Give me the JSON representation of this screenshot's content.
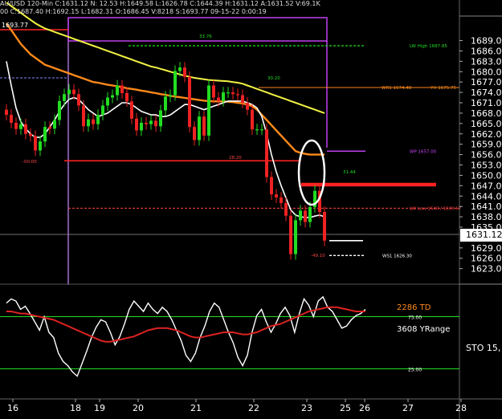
{
  "header": {
    "line1": "AU/USD  120-Min  C:1631.12  N:  12.53  H:1649.58  L:1626.78  C:1644.39  H:1631.12  A:1631.52  V:69.1K",
    "line2": "00  C:1687.40  H:1692.15  L:1682.31  O:1686.45  V:8218  S:1693.77  09-15-22  0:00:19",
    "left_price_label": "1693.77"
  },
  "colors": {
    "background": "#000000",
    "bull": "#22dd22",
    "bear": "#ee2222",
    "ma_fast": "#ffffff",
    "ma_mid": "#ff8a1a",
    "ma_slow": "#f2f244",
    "stoch_k": "#ffffff",
    "stoch_d": "#dd2222",
    "magenta": "#cc44ff",
    "current_price_box": "#ffffff"
  },
  "current_price": "1631.12",
  "chart_data": [
    {
      "type": "candlestick",
      "ylim": [
        1621,
        1694
      ],
      "x_tick_labels": [
        {
          "label": "16",
          "index": -2
        },
        {
          "label": "18",
          "index": 11
        },
        {
          "label": "19",
          "index": 16
        },
        {
          "label": "20",
          "index": 24
        },
        {
          "label": "21",
          "index": 36
        },
        {
          "label": "22",
          "index": 48
        },
        {
          "label": "23",
          "index": 59
        },
        {
          "label": "25",
          "index": 67
        },
        {
          "label": "26",
          "index": 71
        },
        {
          "label": "27",
          "index": 80
        },
        {
          "label": "28",
          "index": 91
        }
      ],
      "y_tick_labels": [
        "1689.00",
        "1686.00",
        "1683.00",
        "1680.00",
        "1677.00",
        "1674.00",
        "1671.00",
        "1668.00",
        "1665.00",
        "1662.00",
        "1659.00",
        "1656.00",
        "1653.00",
        "1650.00",
        "1647.00",
        "1644.00",
        "1641.00",
        "1638.00",
        "1635.00",
        "1629.00",
        "1626.00",
        "1623.00"
      ],
      "y_tick_values": [
        1689,
        1686,
        1683,
        1680,
        1677,
        1674,
        1671,
        1668,
        1665,
        1662,
        1659,
        1656,
        1653,
        1650,
        1647,
        1644,
        1641,
        1638,
        1635,
        1629,
        1626,
        1623
      ],
      "candles_close": [
        1667.5,
        1665.2,
        1663.4,
        1664.8,
        1662.0,
        1661.4,
        1657.2,
        1659.8,
        1664.0,
        1663.5,
        1666.0,
        1671.5,
        1673.5,
        1674.8,
        1673.5,
        1670.2,
        1664.2,
        1666.2,
        1664.8,
        1667.5,
        1670.2,
        1672.5,
        1673.2,
        1676.0,
        1673.8,
        1671.4,
        1666.4,
        1663.0,
        1665.2,
        1664.8,
        1665.8,
        1664.2,
        1668.8,
        1672.8,
        1673.2,
        1680.2,
        1681.2,
        1678.5,
        1664.0,
        1660.2,
        1667.0,
        1661.5,
        1676.0,
        1672.5,
        1671.5,
        1674.0,
        1674.0,
        1673.5,
        1673.2,
        1671.0,
        1669.0,
        1663.3,
        1663.3,
        1663.3,
        1649.5,
        1644.5,
        1643.6,
        1642.0,
        1638.3,
        1627.2,
        1637.0,
        1639.8,
        1636.5,
        1640.8,
        1645.5,
        1639.4,
        1631.1
      ],
      "candles_open": [
        1669.0,
        1667.5,
        1665.2,
        1663.4,
        1664.8,
        1662.0,
        1661.4,
        1657.2,
        1659.8,
        1664.0,
        1663.5,
        1666.0,
        1671.5,
        1673.5,
        1674.8,
        1673.5,
        1670.2,
        1664.2,
        1666.2,
        1664.8,
        1667.5,
        1670.2,
        1672.5,
        1673.2,
        1676.0,
        1673.8,
        1671.4,
        1666.4,
        1663.0,
        1665.2,
        1664.8,
        1665.8,
        1664.2,
        1668.8,
        1672.8,
        1673.2,
        1680.2,
        1681.2,
        1678.5,
        1664.0,
        1660.2,
        1667.0,
        1661.5,
        1676.0,
        1672.5,
        1671.5,
        1674.0,
        1674.0,
        1673.5,
        1673.2,
        1671.0,
        1669.0,
        1663.3,
        1663.3,
        1663.3,
        1649.5,
        1644.5,
        1643.6,
        1642.0,
        1638.3,
        1627.2,
        1637.0,
        1639.8,
        1636.5,
        1640.8,
        1645.5,
        1639.4
      ],
      "ma_fast": [
        1683.0,
        1676.0,
        1669.5,
        1665.5,
        1663.5,
        1662.0,
        1661.0,
        1661.0,
        1662.0,
        1664.0,
        1666.0,
        1668.5,
        1670.5,
        1672.0,
        1672.5,
        1672.0,
        1670.5,
        1669.0,
        1668.0,
        1667.0,
        1667.5,
        1668.0,
        1669.0,
        1670.0,
        1671.0,
        1671.0,
        1670.5,
        1669.5,
        1668.5,
        1668.0,
        1667.5,
        1667.5,
        1667.0,
        1667.0,
        1667.5,
        1668.5,
        1669.5,
        1670.5,
        1670.5,
        1670.0,
        1669.5,
        1669.0,
        1669.5,
        1670.0,
        1670.5,
        1671.0,
        1671.5,
        1671.5,
        1671.5,
        1671.5,
        1671.0,
        1670.5,
        1669.5,
        1667.0,
        1662.0,
        1656.0,
        1651.0,
        1647.0,
        1643.5,
        1640.0,
        1638.5,
        1638.0,
        1637.8,
        1637.8,
        1638.2,
        1638.5,
        1638.0
      ],
      "ma_mid": [
        1694.0,
        1692.0,
        1690.0,
        1688.0,
        1686.5,
        1685.0,
        1684.0,
        1683.0,
        1682.0,
        1681.5,
        1681.0,
        1680.5,
        1680.0,
        1679.5,
        1679.0,
        1678.5,
        1678.0,
        1677.5,
        1677.0,
        1676.8,
        1676.5,
        1676.2,
        1676.0,
        1675.8,
        1675.5,
        1675.2,
        1675.0,
        1674.8,
        1674.5,
        1674.3,
        1674.0,
        1673.8,
        1673.5,
        1673.3,
        1673.0,
        1672.8,
        1672.6,
        1672.4,
        1672.2,
        1672.0,
        1671.8,
        1671.6,
        1671.5,
        1671.4,
        1671.4,
        1671.4,
        1671.3,
        1671.2,
        1671.0,
        1670.8,
        1670.5,
        1670.0,
        1669.0,
        1667.5,
        1666.0,
        1664.5,
        1663.0,
        1661.5,
        1660.0,
        1658.5,
        1657.0,
        1656.5,
        1656.2,
        1656.0,
        1656.0,
        1656.0,
        1656.0
      ],
      "ma_slow": [
        1700.0,
        1699.0,
        1698.0,
        1697.0,
        1696.0,
        1695.0,
        1694.0,
        1693.2,
        1692.5,
        1692.0,
        1691.5,
        1691.0,
        1690.5,
        1690.0,
        1689.5,
        1689.0,
        1688.5,
        1688.0,
        1687.5,
        1687.0,
        1686.5,
        1686.0,
        1685.5,
        1685.0,
        1684.5,
        1684.0,
        1683.5,
        1683.0,
        1682.5,
        1682.0,
        1681.5,
        1681.2,
        1680.8,
        1680.4,
        1680.0,
        1679.6,
        1679.2,
        1678.8,
        1678.5,
        1678.2,
        1678.0,
        1677.8,
        1677.6,
        1677.5,
        1677.4,
        1677.3,
        1677.2,
        1677.0,
        1676.8,
        1676.5,
        1676.0,
        1675.5,
        1675.0,
        1674.5,
        1674.0,
        1673.5,
        1673.0,
        1672.5,
        1672.0,
        1671.5,
        1671.0,
        1670.5,
        1670.0,
        1669.5,
        1669.0,
        1668.5,
        1668.0
      ],
      "levels": [
        {
          "price": 1687.5,
          "label": "LW High 1687.85",
          "color": "#22dd22"
        },
        {
          "price": 1675.4,
          "label": "WR1 1674.48",
          "color": "#ff8a1a"
        },
        {
          "price": 1675.4,
          "label": "YH 1675.75",
          "color": "#ff8a1a"
        },
        {
          "price": 1657.0,
          "label": "WP 1657.00",
          "color": "#cc44ff"
        },
        {
          "price": 1654.2,
          "label": "",
          "color": "#ff2222"
        },
        {
          "price": 1647.3,
          "label": "",
          "color": "#ff2222"
        },
        {
          "price": 1640.5,
          "label": "LW Low 1640 / 1600.67",
          "color": "#ff4444"
        },
        {
          "price": 1631.1,
          "label": "",
          "color": "#ffffff"
        },
        {
          "price": 1626.8,
          "label": "WS1 1626.30",
          "color": "#ffffff"
        }
      ],
      "annotations": [
        "33.76",
        "-00.00",
        "28.20",
        "30.20",
        "31.44",
        "-49.10"
      ]
    },
    {
      "type": "line",
      "title": "STO 15,",
      "legend": [
        "2286 TD",
        "3608 YRange"
      ],
      "y_tick_labels": [
        "25.00",
        "75.00"
      ],
      "ylim": [
        0,
        100
      ],
      "series": [
        {
          "values": [
            88,
            92,
            90,
            82,
            85,
            78,
            70,
            62,
            75,
            60,
            55,
            40,
            32,
            28,
            22,
            18,
            30,
            42,
            55,
            65,
            72,
            70,
            60,
            48,
            56,
            68,
            82,
            90,
            85,
            80,
            88,
            82,
            78,
            84,
            80,
            72,
            62,
            52,
            38,
            32,
            40,
            55,
            66,
            80,
            88,
            84,
            72,
            60,
            50,
            36,
            28,
            38,
            60,
            76,
            82,
            70,
            60,
            68,
            78,
            84,
            76,
            60,
            78,
            92,
            86,
            75,
            90,
            94,
            84,
            80,
            72,
            64,
            66,
            72,
            76,
            78,
            82
          ]
        },
        {
          "values": [
            80,
            80,
            79,
            78,
            78,
            77,
            76,
            75,
            74,
            73,
            72,
            70,
            68,
            66,
            64,
            62,
            60,
            58,
            56,
            54,
            52,
            51,
            51,
            52,
            53,
            54,
            55,
            56,
            58,
            60,
            62,
            63,
            64,
            64,
            64,
            63,
            62,
            60,
            58,
            56,
            55,
            55,
            56,
            57,
            58,
            59,
            60,
            60,
            60,
            59,
            58,
            58,
            59,
            60,
            62,
            64,
            66,
            67,
            68,
            70,
            72,
            74,
            76,
            78,
            80,
            81,
            82,
            83,
            84,
            84,
            84,
            83,
            82,
            81,
            80,
            80,
            80
          ]
        }
      ]
    }
  ]
}
